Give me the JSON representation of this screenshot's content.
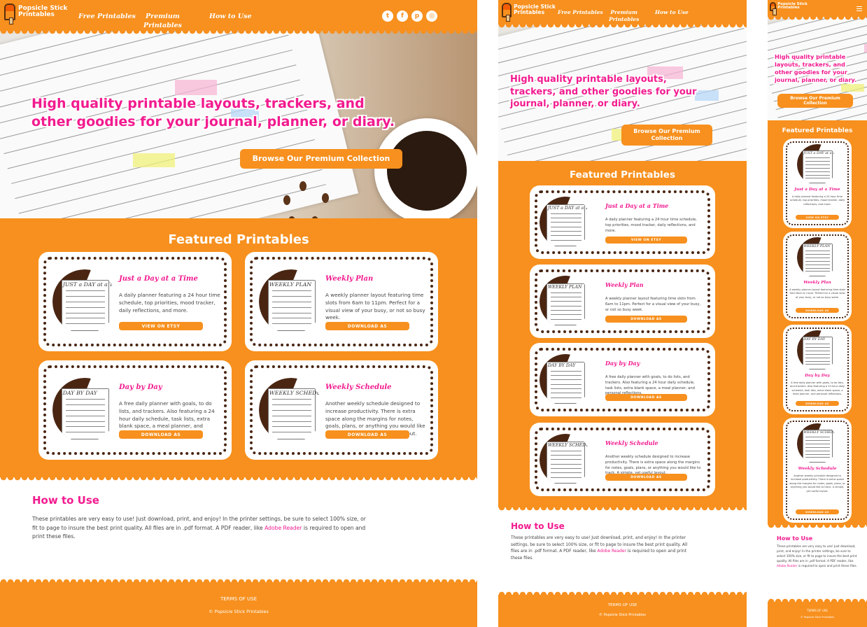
{
  "brand": {
    "name_line1": "Popsicle Stick",
    "name_line2": "Printables"
  },
  "nav": {
    "free": "Free Printables",
    "premium_line1": "Premium",
    "premium_line2": "Printables",
    "howto": "How to Use"
  },
  "social": [
    {
      "icon": "twitter-icon",
      "glyph": "t"
    },
    {
      "icon": "facebook-icon",
      "glyph": "f"
    },
    {
      "icon": "pinterest-icon",
      "glyph": "p"
    },
    {
      "icon": "instagram-icon",
      "glyph": "◎"
    }
  ],
  "hero": {
    "title": "High quality printable layouts, trackers, and other goodies for your journal, planner, or diary.",
    "cta": "Browse Our Premium Collection"
  },
  "featured": {
    "title": "Featured Printables",
    "cards": [
      {
        "title": "Just a Day at a Time",
        "thumb_title": "JUST a DAY at a TIME",
        "desc": "A daily planner featuring a 24 hour time schedule, top priorities, mood tracker, daily reflections, and more.",
        "button": "VIEW ON ETSY"
      },
      {
        "title": "Weekly Plan",
        "thumb_title": "WEEKLY PLAN",
        "desc": "A weekly planner layout featuring time slots from 6am to 11pm. Perfect for a visual view of your busy, or not so busy week.",
        "button": "DOWNLOAD AS"
      },
      {
        "title": "Day by Day",
        "thumb_title": "DAY BY DAY",
        "desc": "A free daily planner with goals, to do lists, and trackers. Also featuring a 24 hour daily schedule, task lists, extra blank space, a meal planner, and personal reflections.",
        "button": "DOWNLOAD AS"
      },
      {
        "title": "Weekly Schedule",
        "thumb_title": "WEEKLY SCHEDULE",
        "desc": "Another weekly schedule designed to increase productivity. There is extra space along the margins for notes, goals, plans, or anything you would like to track. A simple, yet useful layout.",
        "button": "DOWNLOAD AS"
      }
    ]
  },
  "howto": {
    "title": "How to Use",
    "body_before": "These printables are very easy to use! Just download, print, and enjoy! In the printer settings, be sure to select 100% size, or fit to page to insure the best print quality. All files are in .pdf format. A PDF reader, like ",
    "link": "Adobe Reader",
    "body_after": " is required to open and print these files."
  },
  "footer": {
    "terms": "TERMS OF USE",
    "copyright": "© Popsicle Stick Printables"
  },
  "colors": {
    "orange": "#f7901e",
    "pink": "#f21b8f",
    "brown": "#4a2612"
  }
}
